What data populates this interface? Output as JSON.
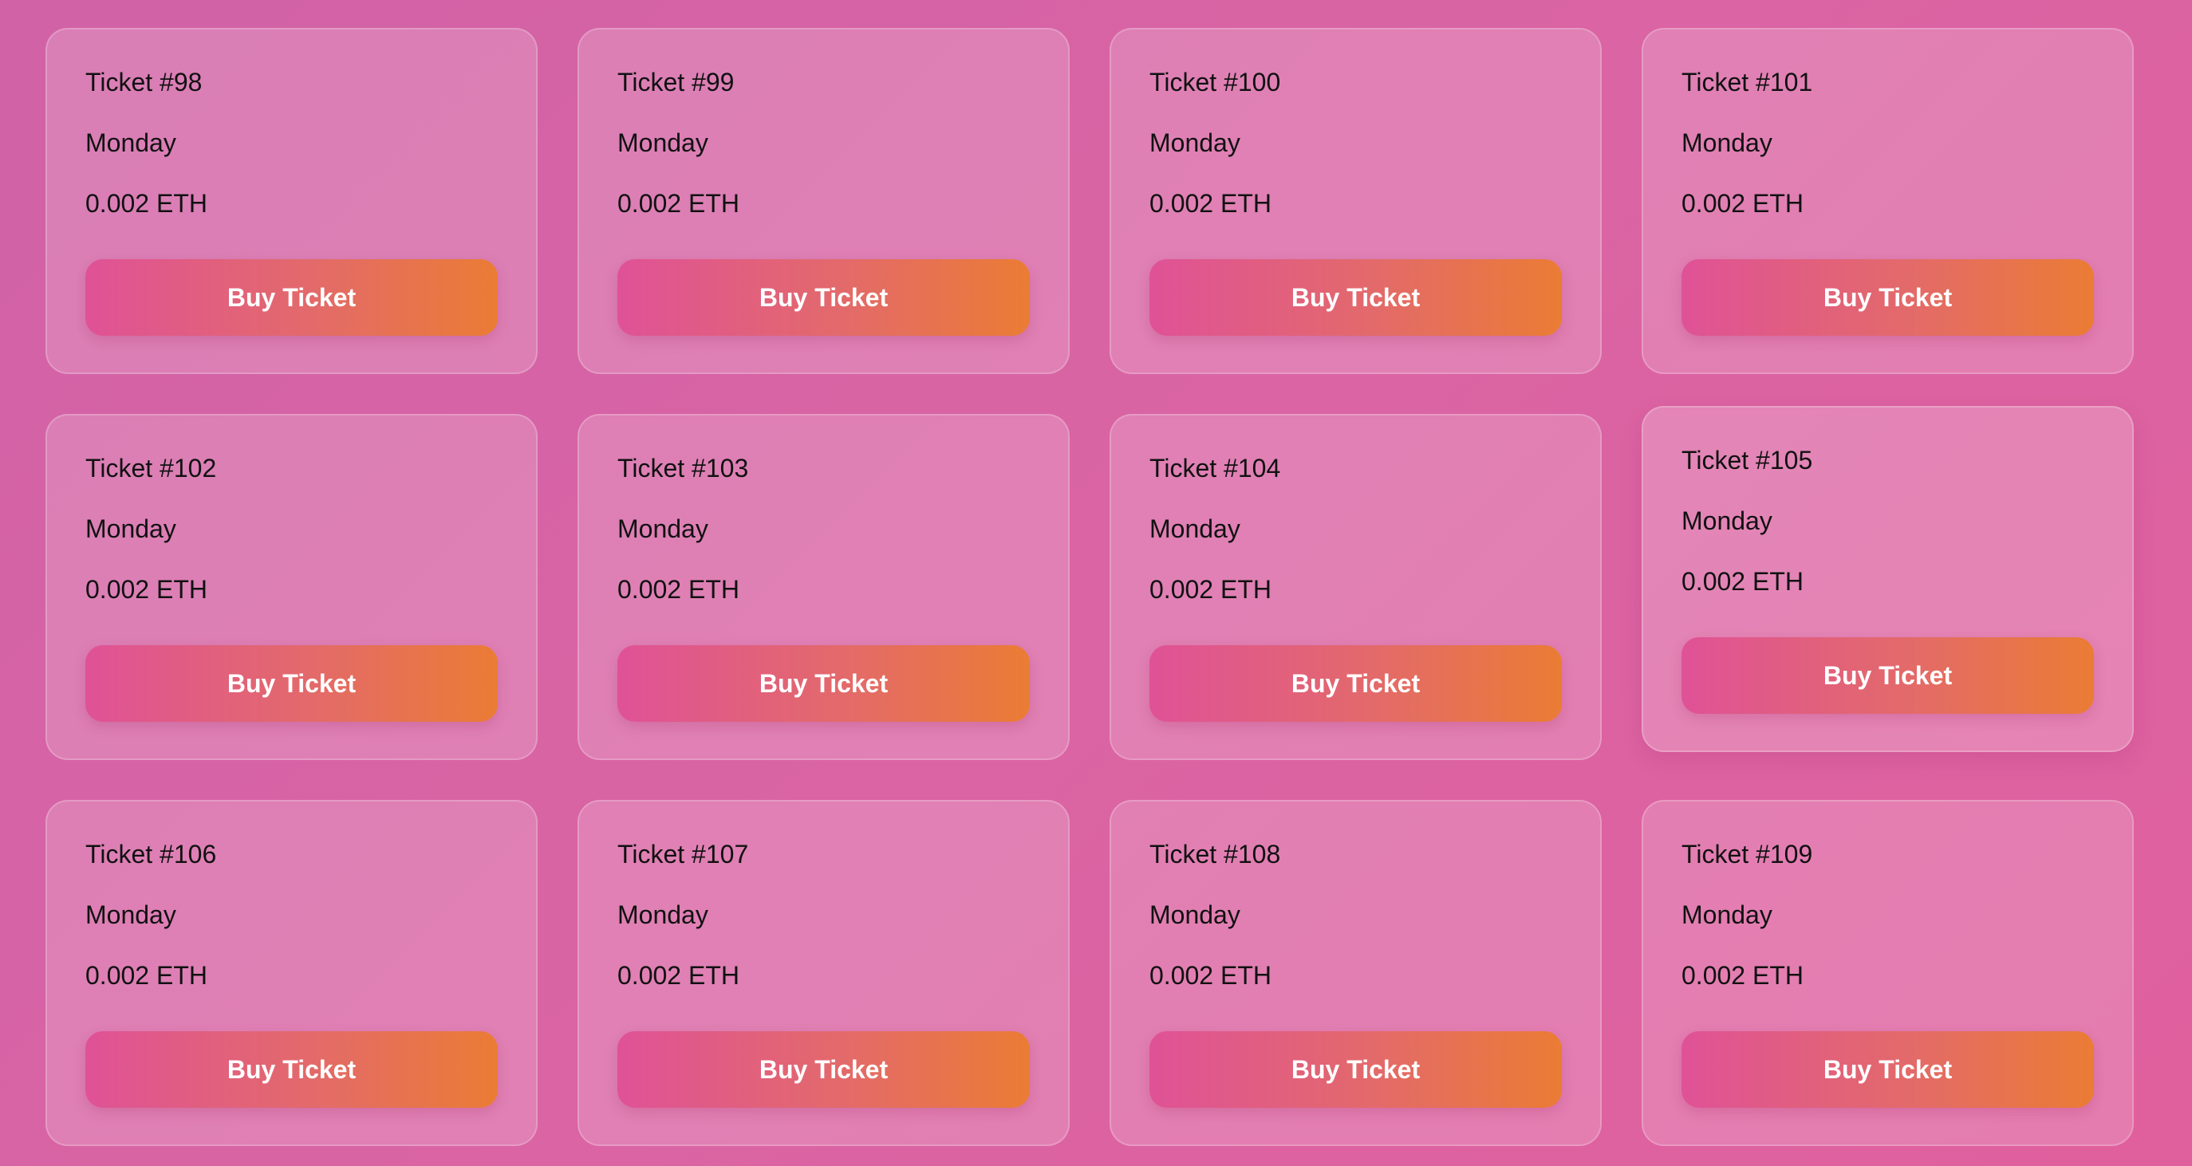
{
  "tickets": [
    {
      "title": "Ticket #98",
      "day": "Monday",
      "price": "0.002 ETH",
      "button_label": "Buy Ticket"
    },
    {
      "title": "Ticket #99",
      "day": "Monday",
      "price": "0.002 ETH",
      "button_label": "Buy Ticket"
    },
    {
      "title": "Ticket #100",
      "day": "Monday",
      "price": "0.002 ETH",
      "button_label": "Buy Ticket"
    },
    {
      "title": "Ticket #101",
      "day": "Monday",
      "price": "0.002 ETH",
      "button_label": "Buy Ticket"
    },
    {
      "title": "Ticket #102",
      "day": "Monday",
      "price": "0.002 ETH",
      "button_label": "Buy Ticket"
    },
    {
      "title": "Ticket #103",
      "day": "Monday",
      "price": "0.002 ETH",
      "button_label": "Buy Ticket"
    },
    {
      "title": "Ticket #104",
      "day": "Monday",
      "price": "0.002 ETH",
      "button_label": "Buy Ticket"
    },
    {
      "title": "Ticket #105",
      "day": "Monday",
      "price": "0.002 ETH",
      "button_label": "Buy Ticket"
    },
    {
      "title": "Ticket #106",
      "day": "Monday",
      "price": "0.002 ETH",
      "button_label": "Buy Ticket"
    },
    {
      "title": "Ticket #107",
      "day": "Monday",
      "price": "0.002 ETH",
      "button_label": "Buy Ticket"
    },
    {
      "title": "Ticket #108",
      "day": "Monday",
      "price": "0.002 ETH",
      "button_label": "Buy Ticket"
    },
    {
      "title": "Ticket #109",
      "day": "Monday",
      "price": "0.002 ETH",
      "button_label": "Buy Ticket"
    }
  ],
  "colors": {
    "background": "#d962a5",
    "button_gradient_start": "#df5297",
    "button_gradient_end": "#ea7c34",
    "button_text": "#ffffff"
  }
}
